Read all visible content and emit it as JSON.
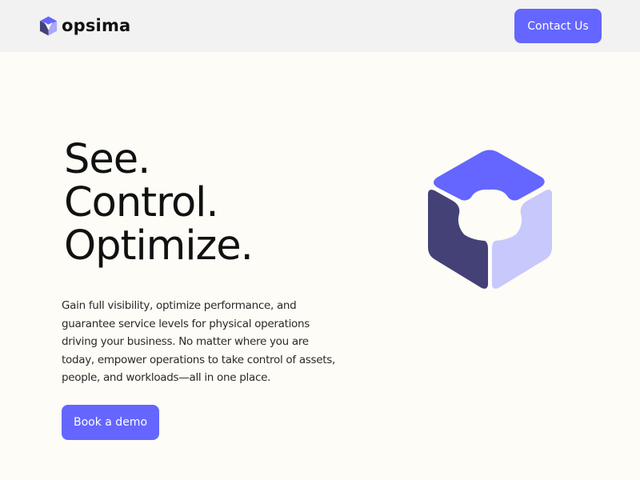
{
  "header": {
    "brand": "opsima",
    "logo_icon": "opsima-cube-logo-icon",
    "contact_label": "Contact Us"
  },
  "hero": {
    "title_lines": [
      "See.",
      "Control.",
      "Optimize."
    ],
    "description": "Gain full visibility, optimize performance, and guarantee service levels for physical operations driving your business. No matter where you are today, empower operations to take control of assets, people, and workloads—all in one place.",
    "cta_label": "Book a demo",
    "illustration_icon": "isometric-cube-icon"
  },
  "colors": {
    "accent": "#6466ff",
    "cube_top": "#6466ff",
    "cube_left": "#444177",
    "cube_right": "#c7c8fb",
    "header_bg": "#f2f2f2",
    "page_bg": "#fdfcf6",
    "text": "#111111"
  }
}
